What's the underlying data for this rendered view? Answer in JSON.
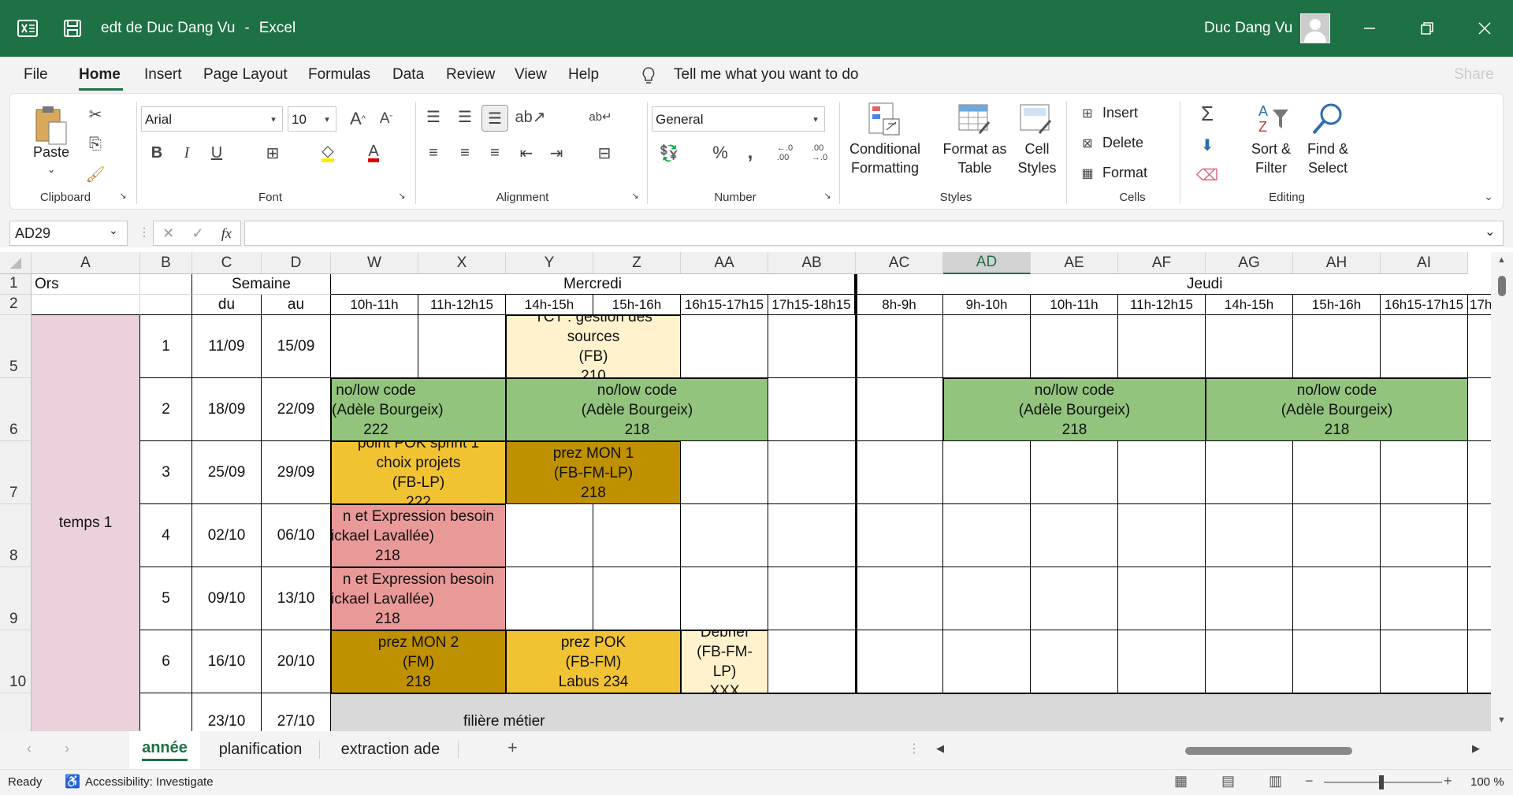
{
  "app": {
    "title": "edt de Duc Dang Vu",
    "separator": "-",
    "app_name": "Excel",
    "user": "Duc Dang Vu",
    "accent": "#1e7145"
  },
  "menu": {
    "tabs": [
      "File",
      "Home",
      "Insert",
      "Page Layout",
      "Formulas",
      "Data",
      "Review",
      "View",
      "Help"
    ],
    "active": "Home",
    "tell_me": "Tell me what you want to do",
    "share": "Share"
  },
  "ribbon": {
    "clipboard": {
      "paste": "Paste",
      "label": "Clipboard"
    },
    "font": {
      "name": "Arial",
      "size": "10",
      "label": "Font"
    },
    "alignment": {
      "label": "Alignment"
    },
    "number": {
      "format": "General",
      "label": "Number",
      "percent": "%",
      "comma": ","
    },
    "styles": {
      "conditional": "Conditional",
      "formatting": "Formatting",
      "format_as": "Format as",
      "table": "Table",
      "cell": "Cell",
      "cell_styles": "Styles",
      "label": "Styles"
    },
    "cells": {
      "insert": "Insert",
      "delete": "Delete",
      "format": "Format",
      "label": "Cells"
    },
    "editing": {
      "sort": "Sort &",
      "filter": "Filter",
      "find": "Find &",
      "select": "Select",
      "label": "Editing"
    }
  },
  "formula_bar": {
    "name_box": "AD29",
    "fx": "fx",
    "content": ""
  },
  "grid": {
    "columns": [
      "A",
      "B",
      "C",
      "D",
      "W",
      "X",
      "Y",
      "Z",
      "AA",
      "AB",
      "AC",
      "AD",
      "AE",
      "AF",
      "AG",
      "AH",
      "AI"
    ],
    "selected_column": "AD",
    "rows": [
      "1",
      "2",
      "5",
      "6",
      "7",
      "8",
      "9",
      "10"
    ],
    "row1": {
      "a": "Ors",
      "semaine": "Semaine",
      "mercredi": "Mercredi",
      "jeudi": "Jeudi"
    },
    "row2": {
      "du": "du",
      "au": "au",
      "slots": [
        "10h-11h",
        "11h-12h15",
        "14h-15h",
        "15h-16h",
        "16h15-17h15",
        "17h15-18h15",
        "8h-9h",
        "9h-10h",
        "10h-11h",
        "11h-12h15",
        "14h-15h",
        "15h-16h",
        "16h15-17h15",
        "17h"
      ]
    },
    "period": "temps 1",
    "weeks": [
      {
        "n": "1",
        "du": "11/09",
        "au": "15/09"
      },
      {
        "n": "2",
        "du": "18/09",
        "au": "22/09"
      },
      {
        "n": "3",
        "du": "25/09",
        "au": "29/09"
      },
      {
        "n": "4",
        "du": "02/10",
        "au": "06/10"
      },
      {
        "n": "5",
        "du": "09/10",
        "au": "13/10"
      },
      {
        "n": "6",
        "du": "16/10",
        "au": "20/10"
      },
      {
        "n": "",
        "du": "23/10",
        "au": "27/10"
      }
    ],
    "events": {
      "tct": [
        "TCT : gestion des",
        "sources",
        "(FB)",
        "210"
      ],
      "nolow_w": [
        "no/low code",
        "(Adèle Bourgeix)",
        "222"
      ],
      "nolow_y": [
        "no/low code",
        "(Adèle Bourgeix)",
        "218"
      ],
      "nolow_ad": [
        "no/low code",
        "(Adèle Bourgeix)",
        "218"
      ],
      "nolow_ag": [
        "no/low code",
        "(Adèle Bourgeix)",
        "218"
      ],
      "pok_sprint": [
        "point POK sprint 1",
        "choix projets",
        "(FB-LP)",
        "222"
      ],
      "prez_mon1": [
        "prez MON 1",
        "(FB-FM-LP)",
        "218"
      ],
      "expr1": [
        "n et Expression besoin",
        "ickael Lavallée)",
        "218"
      ],
      "expr2": [
        "n et Expression besoin",
        "ickael Lavallée)",
        "218"
      ],
      "prez_mon2": [
        "prez MON 2",
        "(FM)",
        "218"
      ],
      "prez_pok": [
        "prez POK",
        "(FB-FM)",
        "Labus 234"
      ],
      "debrief": [
        "Debrief",
        "(FB-FM-",
        "LP)",
        "XXX"
      ],
      "filiere": "filière métier"
    },
    "colors": {
      "green": "#92c47d",
      "yellow": "#f1c232",
      "dark_yellow": "#bf9000",
      "pink": "#ea9999",
      "cream": "#fff2cc",
      "lavender": "#ead1dc",
      "grey": "#d9d9d9"
    }
  },
  "sheets": {
    "tabs": [
      "année",
      "planification",
      "extraction ade"
    ],
    "active": "année"
  },
  "status": {
    "ready": "Ready",
    "accessibility": "Accessibility: Investigate",
    "zoom": "100 %"
  }
}
